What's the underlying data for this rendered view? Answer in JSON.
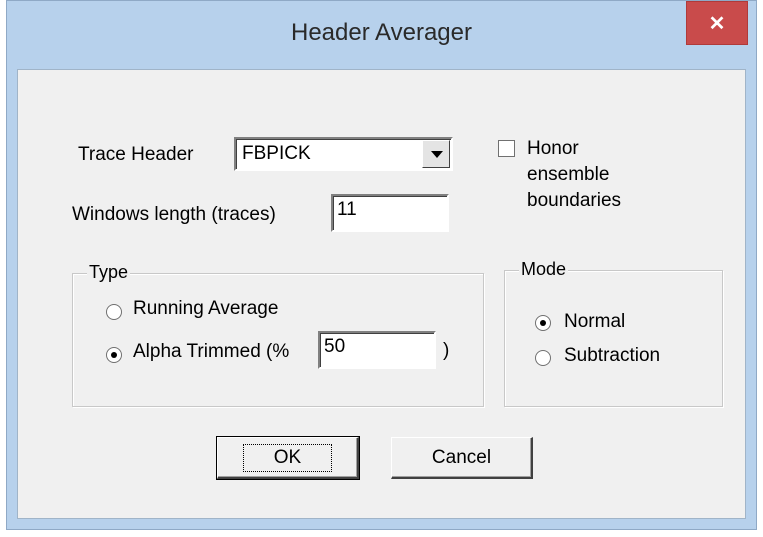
{
  "window": {
    "title": "Header Averager",
    "close_glyph": "✕"
  },
  "trace_header": {
    "label": "Trace Header",
    "value": "FBPICK"
  },
  "honor": {
    "label_line1": "Honor",
    "label_line2": "ensemble",
    "label_line3": "boundaries",
    "checked": false
  },
  "window_length": {
    "label": "Windows length (traces)",
    "value": "11"
  },
  "type_group": {
    "legend": "Type",
    "options": [
      {
        "label": "Running Average",
        "checked": false
      },
      {
        "label": "Alpha Trimmed (%",
        "checked": true
      }
    ],
    "alpha_value": "50",
    "alpha_suffix": ")"
  },
  "mode_group": {
    "legend": "Mode",
    "options": [
      {
        "label": "Normal",
        "checked": true
      },
      {
        "label": "Subtraction",
        "checked": false
      }
    ]
  },
  "buttons": {
    "ok": "OK",
    "cancel": "Cancel"
  },
  "colors": {
    "titlebar": "#b7d1ec",
    "close": "#c94b4b",
    "client": "#f0f0f0"
  }
}
